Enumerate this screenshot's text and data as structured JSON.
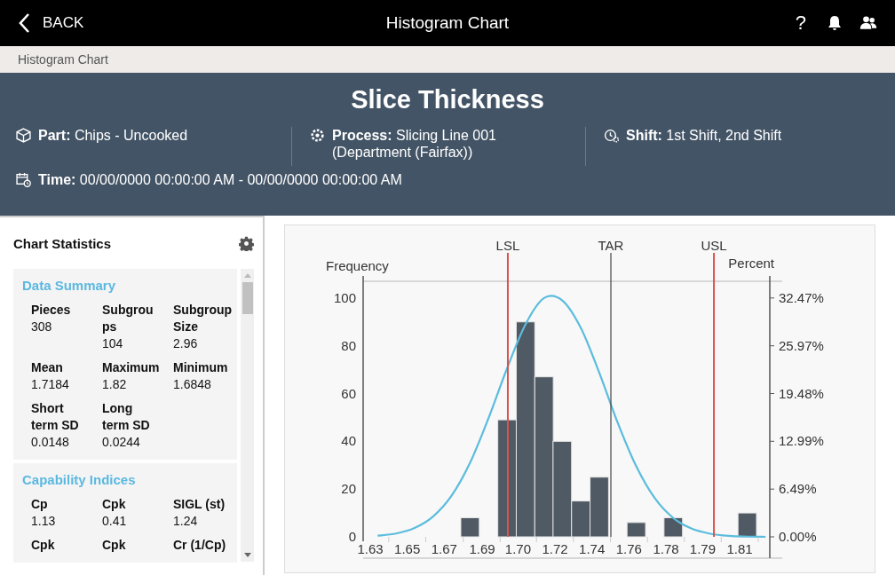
{
  "top_bar": {
    "back_label": "BACK",
    "title": "Histogram Chart",
    "help_label": "?"
  },
  "breadcrumb": "Histogram Chart",
  "header": {
    "title": "Slice Thickness",
    "fields": [
      {
        "kind": "part",
        "label": "Part:",
        "value": "Chips - Uncooked"
      },
      {
        "kind": "process",
        "label": "Process:",
        "value": "Slicing Line 001 (Department (Fairfax))"
      },
      {
        "kind": "shift",
        "label": "Shift:",
        "value": "1st Shift, 2nd Shift"
      }
    ],
    "time": {
      "label": "Time:",
      "value": "00/00/0000 00:00:00 AM - 00/00/0000 00:00:00 AM"
    }
  },
  "statistics": {
    "title": "Chart Statistics",
    "sections": [
      {
        "title": "Data Summary",
        "items": [
          {
            "label": "Pieces",
            "value": "308"
          },
          {
            "label": "Subgroups",
            "value": "104"
          },
          {
            "label": "Subgroup Size",
            "value": "2.96"
          },
          {
            "label": "Mean",
            "value": "1.7184"
          },
          {
            "label": "Maximum",
            "value": "1.82"
          },
          {
            "label": "Minimum",
            "value": "1.6848"
          },
          {
            "label": "Short term SD",
            "value": "0.0148"
          },
          {
            "label": "Long term SD",
            "value": "0.0244"
          }
        ]
      },
      {
        "title": "Capability Indices",
        "items": [
          {
            "label": "Cp",
            "value": "1.13"
          },
          {
            "label": "Cpk",
            "value": "0.41"
          },
          {
            "label": "SIGL (st)",
            "value": "1.24"
          },
          {
            "label": "Cpk"
          },
          {
            "label": "Cpk"
          },
          {
            "label": "Cr (1/Cp)"
          }
        ]
      }
    ]
  },
  "chart": {
    "chart_data": {
      "type": "bar",
      "ylabel": "Frequency",
      "y2label": "Percent",
      "x": [
        1.6336,
        1.6427,
        1.6518,
        1.6609,
        1.67,
        1.6791,
        1.6882,
        1.6973,
        1.7064,
        1.7155,
        1.7245,
        1.7336,
        1.7427,
        1.7518,
        1.7609,
        1.77,
        1.7791,
        1.7882,
        1.7973,
        1.8064,
        1.8155,
        1.8245
      ],
      "series": [
        {
          "type": "bar",
          "color": "#505a64",
          "values": [
            0,
            0,
            0,
            0,
            0,
            8,
            0,
            49,
            90,
            67,
            40,
            15,
            25,
            0,
            6,
            0,
            8,
            0,
            0,
            0,
            10,
            0
          ]
        },
        {
          "type": "line",
          "color": "#5bbcdd",
          "values": [
            0.5,
            1.4,
            3.7,
            8.5,
            17.2,
            31,
            49.7,
            70.5,
            89,
            100,
            99,
            87.5,
            68.7,
            47.7,
            29.5,
            16.2,
            7.9,
            3.4,
            1.3,
            0.4,
            0.1,
            0
          ]
        }
      ],
      "xlim": [
        1.6265,
        1.8266
      ],
      "ylim": [
        0,
        107
      ],
      "y2lim": [
        0,
        34.74
      ],
      "xticks": [
        {
          "value": 1.63,
          "label": "1.63"
        },
        {
          "value": 1.6482,
          "label": "1.65"
        },
        {
          "value": 1.6664,
          "label": "1.67"
        },
        {
          "value": 1.6851,
          "label": "1.69"
        },
        {
          "value": 1.7027,
          "label": "1.70"
        },
        {
          "value": 1.7209,
          "label": "1.72"
        },
        {
          "value": 1.7391,
          "label": "1.74"
        },
        {
          "value": 1.7573,
          "label": "1.76"
        },
        {
          "value": 1.7755,
          "label": "1.78"
        },
        {
          "value": 1.7936,
          "label": "1.79"
        },
        {
          "value": 1.8118,
          "label": "1.81"
        }
      ],
      "yticks": [
        0,
        20,
        40,
        60,
        80,
        100
      ],
      "y2ticks": [
        {
          "value": 0,
          "label": "0.00%"
        },
        {
          "value": 6.49,
          "label": "6.49%"
        },
        {
          "value": 12.99,
          "label": "12.99%"
        },
        {
          "value": 19.48,
          "label": "19.48%"
        },
        {
          "value": 25.97,
          "label": "25.97%"
        },
        {
          "value": 32.47,
          "label": "32.47%"
        }
      ],
      "ref_lines": [
        {
          "axis": "x",
          "value": 1.6977,
          "label": "LSL",
          "color": "#d9534f"
        },
        {
          "axis": "x",
          "value": 1.7484,
          "label": "TAR",
          "color": "#444444"
        },
        {
          "axis": "x",
          "value": 1.7991,
          "label": "USL",
          "color": "#d9534f"
        }
      ]
    }
  }
}
